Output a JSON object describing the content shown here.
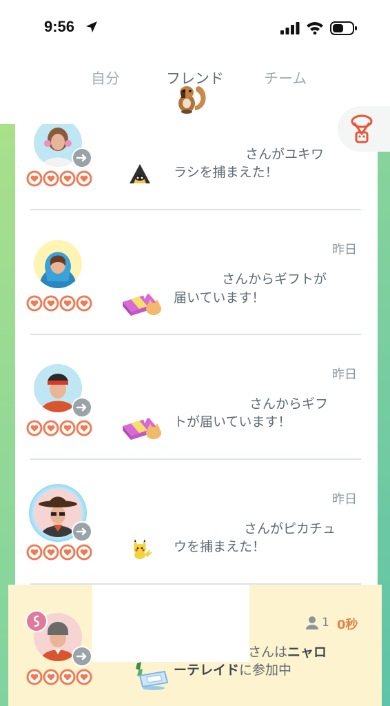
{
  "status_bar": {
    "time": "9:56"
  },
  "tabs": [
    {
      "label": "自分"
    },
    {
      "label": "フレンド"
    },
    {
      "label": "チーム"
    }
  ],
  "feed": [
    {
      "date": "",
      "line1": "さんがユキワ",
      "line2": "ラシを捕まえた！"
    },
    {
      "date": "昨日",
      "line1": "さんからギフトが",
      "line2": "届いています！"
    },
    {
      "date": "昨日",
      "line1": "さんからギフ",
      "line2": "トが届いています！"
    },
    {
      "date": "昨日",
      "line1": "さんがピカチュ",
      "line2": "ウを捕まえた！"
    }
  ],
  "raid": {
    "participants": "1",
    "time": "0秒",
    "line1_prefix": "さんは",
    "line1_bold": "ニャロ",
    "line2_bold": "ーテレイド",
    "line2_suffix": "に参加中"
  },
  "colors": {
    "heart": "#ef7b55",
    "accent": "#e0834c",
    "raid_bg": "#fdf3cf"
  }
}
